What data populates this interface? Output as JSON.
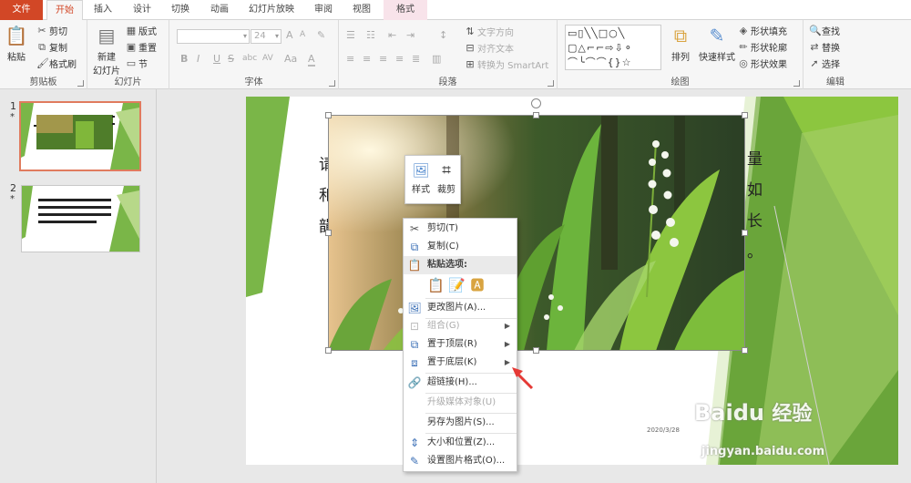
{
  "tabs": [
    {
      "label": "文件"
    },
    {
      "label": "开始"
    },
    {
      "label": "插入"
    },
    {
      "label": "设计"
    },
    {
      "label": "切换"
    },
    {
      "label": "动画"
    },
    {
      "label": "幻灯片放映"
    },
    {
      "label": "审阅"
    },
    {
      "label": "视图"
    },
    {
      "label": "格式"
    }
  ],
  "ribbon": {
    "clipboard": {
      "label": "剪贴板",
      "paste": "粘贴",
      "cut": "剪切",
      "copy": "复制",
      "painter": "格式刷"
    },
    "slides": {
      "label": "幻灯片",
      "new_slide_line1": "新建",
      "new_slide_line2": "幻灯片",
      "layout": "版式",
      "reset": "重置",
      "section": "节"
    },
    "font": {
      "label": "字体",
      "font_size": "24",
      "bold": "B",
      "italic": "I",
      "underline": "U",
      "strike": "S",
      "shadow": "abc",
      "spacing": "AV",
      "case": "Aa",
      "color": "A",
      "grow": "A",
      "shrink": "A"
    },
    "paragraph": {
      "label": "段落",
      "text_dir": "文字方向",
      "align_text": "对齐文本",
      "smartart": "转换为 SmartArt"
    },
    "drawing": {
      "label": "绘图",
      "arrange": "排列",
      "quick_styles": "快速样式",
      "fill": "形状填充",
      "outline": "形状轮廓",
      "effects": "形状效果",
      "shapes_row1": "▭▯╲╲□○╲",
      "shapes_row2": "▢△⌐⌐⇨⇩⚬",
      "shapes_row3": "⌒╰⌒⌒{}☆"
    },
    "editing": {
      "label": "编辑",
      "find": "查找",
      "replace": "替换",
      "select": "选择"
    }
  },
  "thumbnails": [
    {
      "num": "1",
      "star": "*"
    },
    {
      "num": "2",
      "star": "*"
    }
  ],
  "slide": {
    "left_chars": [
      "请",
      "和",
      "韻"
    ],
    "right_chars": [
      "量",
      "如",
      "长",
      "。"
    ],
    "date": "2020/3/28"
  },
  "mini_toolbar": {
    "style": "样式",
    "crop": "裁剪"
  },
  "context_menu": {
    "cut": "剪切(T)",
    "copy": "复制(C)",
    "paste_options": "粘贴选项:",
    "change_picture": "更改图片(A)...",
    "group": "组合(G)",
    "bring_front": "置于顶层(R)",
    "send_back": "置于底层(K)",
    "hyperlink": "超链接(H)...",
    "upgrade_media": "升级媒体对象(U)",
    "save_as_picture": "另存为图片(S)...",
    "size_position": "大小和位置(Z)...",
    "format_picture": "设置图片格式(O)..."
  },
  "watermark": {
    "brand": "Baidu",
    "sub": "经验",
    "url": "jingyan.baidu.com"
  },
  "colors": {
    "accent": "#d24726",
    "slide_green": "#7ab648",
    "light_green": "#b7d889"
  }
}
